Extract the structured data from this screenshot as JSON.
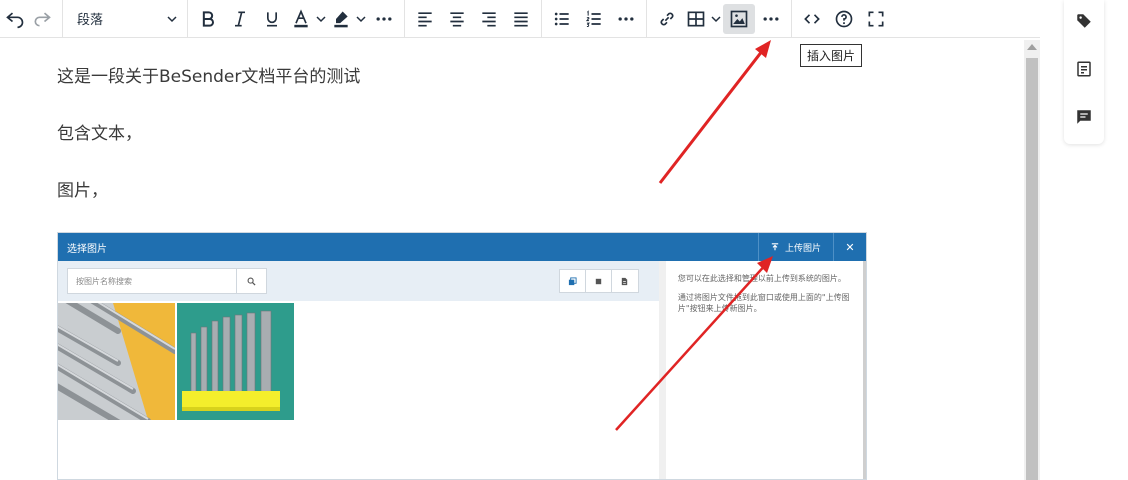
{
  "toolbar": {
    "block_format": "段落",
    "insert_image_tooltip": "插入图片"
  },
  "document": {
    "paragraphs": [
      "这是一段关于BeSender文档平台的测试",
      "包含文本，",
      "图片，"
    ]
  },
  "image_dialog": {
    "title": "选择图片",
    "upload_label": "上传图片",
    "close_label": "✕",
    "search_placeholder": "按图片名称搜索",
    "help_text_1": "您可以在此选择和管理以前上传到系统的图片。",
    "help_text_2": "通过将图片文件拖到此窗口或使用上面的\"上传图片\"按钮来上传新图片。"
  },
  "sidebar": {
    "icons": [
      "tag-icon",
      "form-icon",
      "comment-icon"
    ]
  },
  "colors": {
    "dialog_header": "#1f6fb0",
    "annotation_arrow": "#e02424",
    "toolbar_active": "#dee0e2"
  }
}
